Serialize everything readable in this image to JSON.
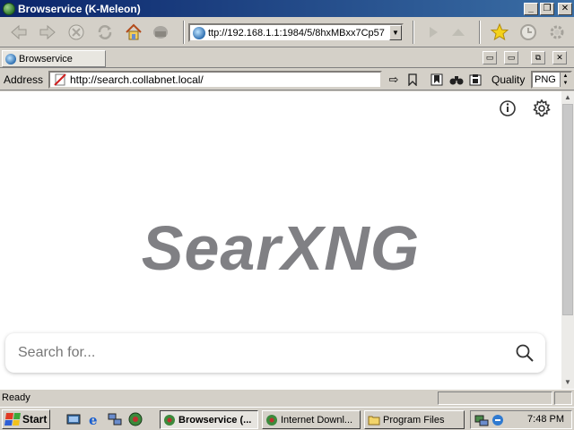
{
  "window": {
    "title": "Browservice (K-Meleon)",
    "controls": {
      "minimize": "_",
      "maximize": "❐",
      "close": "✕"
    }
  },
  "toolbar": {
    "url_combo_value": "ttp://192.168.1.1:1984/5/8hxMBxx7Cp57",
    "icons": [
      "back-icon",
      "forward-icon",
      "stop-icon",
      "reload-icon",
      "home-icon",
      "print-icon",
      "go-icon",
      "up-icon",
      "bookmark-star-icon",
      "history-icon",
      "settings-gear-icon"
    ]
  },
  "tabs": [
    {
      "label": "Browservice",
      "active": true
    }
  ],
  "address_bar": {
    "label": "Address",
    "url": "http://search.collabnet.local/",
    "quality_label": "Quality",
    "quality_value": "PNG"
  },
  "page": {
    "logo_text": "SearXNG",
    "search_placeholder": "Search for...",
    "icons": [
      "info-icon",
      "settings-icon",
      "search-icon"
    ]
  },
  "status_bar": {
    "text": "Ready"
  },
  "taskbar": {
    "start_label": "Start",
    "tasks": [
      {
        "label": "Browservice (...",
        "active": true
      },
      {
        "label": "Internet Downl...",
        "active": false
      },
      {
        "label": "Program Files",
        "active": false
      }
    ],
    "clock": "7:48 PM"
  },
  "colors": {
    "title_bar": "#0a246a",
    "chrome": "#d4d0c8",
    "logo": "#808084"
  }
}
